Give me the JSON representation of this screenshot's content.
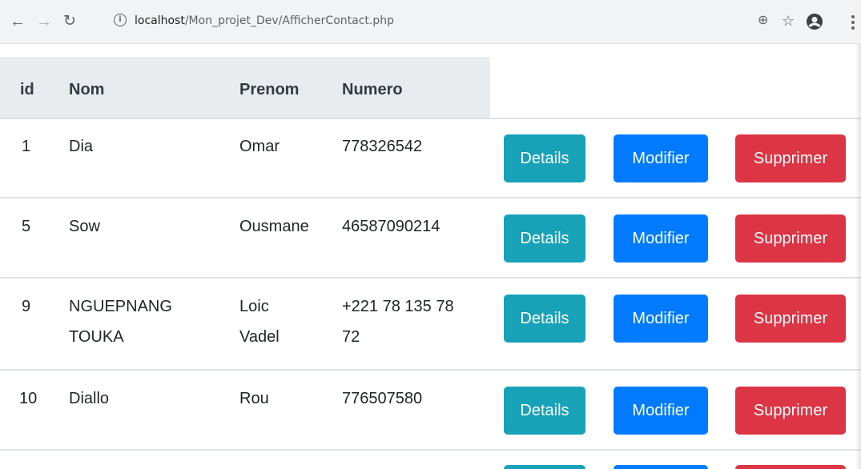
{
  "browser": {
    "back_icon": "arrow-left-icon",
    "forward_icon": "arrow-right-icon",
    "reload_icon": "reload-icon",
    "info_glyph": "i",
    "url_host": "localhost",
    "url_path": "/Mon_projet_Dev/AfficherContact.php",
    "zoom_icon": "zoom-icon",
    "star_icon": "bookmark-star-icon",
    "account_icon": "account-icon",
    "menu_icon": "kebab-menu-icon"
  },
  "table": {
    "headers": {
      "id": "id",
      "nom": "Nom",
      "prenom": "Prenom",
      "numero": "Numero"
    },
    "rows": [
      {
        "id": "1",
        "nom": [
          "Dia"
        ],
        "prenom": [
          "Omar"
        ],
        "numero": [
          "778326542"
        ]
      },
      {
        "id": "5",
        "nom": [
          "Sow"
        ],
        "prenom": [
          "Ousmane"
        ],
        "numero": [
          "46587090214"
        ]
      },
      {
        "id": "9",
        "nom": [
          "NGUEPNANG",
          "TOUKA"
        ],
        "prenom": [
          "Loic",
          "Vadel"
        ],
        "numero": [
          "+221 78 135 78",
          "72"
        ]
      },
      {
        "id": "10",
        "nom": [
          "Diallo"
        ],
        "prenom": [
          "Rou"
        ],
        "numero": [
          "776507580"
        ]
      }
    ],
    "actions": {
      "details": "Details",
      "modifier": "Modifier",
      "supprimer": "Supprimer"
    }
  },
  "colors": {
    "details": "#17a2b8",
    "modifier": "#007bff",
    "supprimer": "#dc3545",
    "header_bg": "#e9ecef"
  }
}
